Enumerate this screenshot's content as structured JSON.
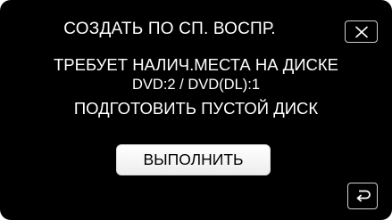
{
  "dialog": {
    "title": "СОЗДАТЬ ПО СП. ВОСПР.",
    "message_line1": "ТРЕБУЕТ НАЛИЧ.МЕСТА НА ДИСКЕ",
    "message_line2": "DVD:2 / DVD(DL):1",
    "message_line3": "ПОДГОТОВИТЬ ПУСТОЙ ДИСК",
    "execute_label": "ВЫПОЛНИТЬ"
  },
  "icons": {
    "close": "close-icon",
    "back": "return-arrow-icon"
  },
  "colors": {
    "background": "#000000",
    "text": "#ffffff",
    "button_fill": "#ffffff",
    "button_text": "#000000",
    "icon_border": "#cfcfcf"
  }
}
